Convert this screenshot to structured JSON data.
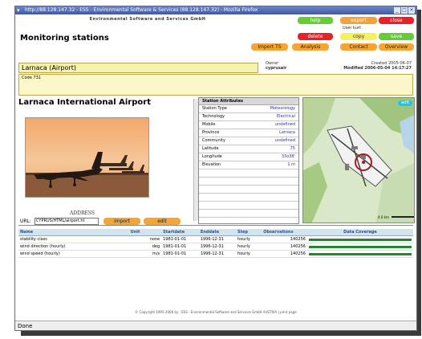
{
  "window": {
    "title": "http://88.128.147.32 - ESS - Environmental Software & Services (88.128.147.32) - Mozilla Firefox",
    "status": "Done"
  },
  "header": {
    "company": "Environmental Software and Services GmbH",
    "page_title": "Monitoring stations",
    "user_label": "User kurt"
  },
  "buttons": {
    "help": "help",
    "export": "export",
    "close": "close",
    "delete": "delete",
    "copy": "copy",
    "save": "save",
    "import_ts": "Import TS",
    "analysis": "Analysis",
    "contact": "Contact",
    "overview": "Overview"
  },
  "station": {
    "name_field": "Larnaca (Airport)",
    "owner_label": "Owner",
    "owner_value": "cyprusair",
    "created": "Created 2005-06-07",
    "modified": "Modified 2006-05-04 14:17:27",
    "code": "Code 731",
    "heading": "Larnaca International Airport",
    "address_label": "ADDRESS",
    "url_label": "URL:",
    "url_value": "CYPRUS/HTML/airport.ht",
    "import_btn": "import",
    "edit_btn": "edit"
  },
  "attributes": {
    "title": "Station Attributes",
    "rows": [
      {
        "key": "Station Type",
        "value": "Meteorology"
      },
      {
        "key": "Technology",
        "value": "Electrical"
      },
      {
        "key": "Mobile",
        "value": "undefined"
      },
      {
        "key": "Province",
        "value": "Larnaca"
      },
      {
        "key": "Community",
        "value": "undefined"
      },
      {
        "key": "Latitude",
        "value": "75"
      },
      {
        "key": "Longitude",
        "value": "33o38'"
      },
      {
        "key": "Elevation",
        "value": "1 m"
      }
    ]
  },
  "map": {
    "edit_label": "edit",
    "scale_label": "4.0 km"
  },
  "table": {
    "headers": [
      "Name",
      "Unit",
      "Startdate",
      "Enddate",
      "Step",
      "Observations",
      "Data Coverage"
    ],
    "rows": [
      {
        "name": "stability class",
        "unit": "none",
        "start": "1981-01-01",
        "end": "1996-12-31",
        "step": "hourly",
        "obs": "140256",
        "coverage": 1.0
      },
      {
        "name": "wind direction (hourly)",
        "unit": "deg",
        "start": "1981-01-01",
        "end": "1996-12-31",
        "step": "hourly",
        "obs": "140256",
        "coverage": 1.0
      },
      {
        "name": "wind speed (hourly)",
        "unit": "m/s",
        "start": "1981-01-01",
        "end": "1996-12-31",
        "step": "hourly",
        "obs": "140256",
        "coverage": 1.0
      }
    ]
  },
  "footer": {
    "text": "© Copyright 1995-2006 by : ESS - Environmental Software and Services GmbH AUSTRIA | print page"
  }
}
